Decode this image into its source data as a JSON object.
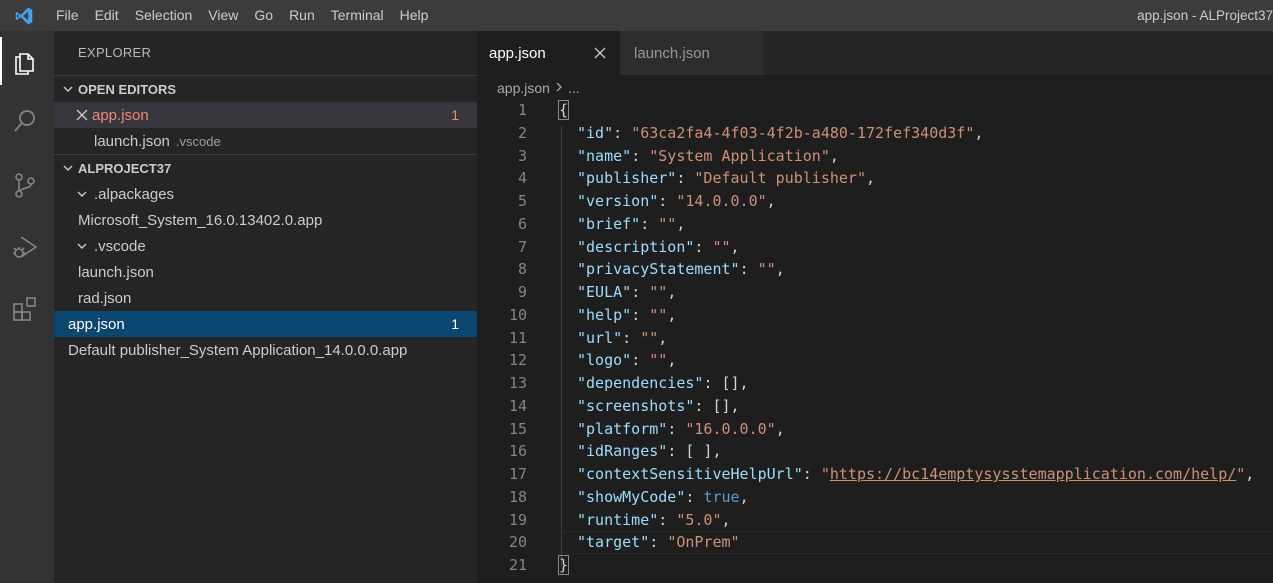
{
  "titlebar": {
    "menu": [
      "File",
      "Edit",
      "Selection",
      "View",
      "Go",
      "Run",
      "Terminal",
      "Help"
    ],
    "window_title": "app.json - ALProject37"
  },
  "activity_bar": {
    "icons": [
      "explorer-icon",
      "search-icon",
      "source-control-icon",
      "run-debug-icon",
      "extensions-icon"
    ]
  },
  "sidebar": {
    "title": "EXPLORER",
    "open_editors": {
      "header": "OPEN EDITORS",
      "items": [
        {
          "name": "app.json",
          "badge": "1"
        },
        {
          "name": "launch.json",
          "desc": ".vscode"
        }
      ]
    },
    "project": {
      "header": "ALPROJECT37",
      "items": [
        {
          "name": ".alpackages"
        },
        {
          "name": "Microsoft_System_16.0.13402.0.app"
        },
        {
          "name": ".vscode"
        },
        {
          "name": "launch.json"
        },
        {
          "name": "rad.json"
        },
        {
          "name": "app.json",
          "badge": "1"
        },
        {
          "name": "Default publisher_System Application_14.0.0.0.app"
        }
      ]
    }
  },
  "tabs": [
    {
      "label": "app.json"
    },
    {
      "label": "launch.json"
    }
  ],
  "breadcrumb": {
    "file": "app.json",
    "rest": "..."
  },
  "editor": {
    "line_numbers": [
      "1",
      "2",
      "3",
      "4",
      "5",
      "6",
      "7",
      "8",
      "9",
      "10",
      "11",
      "12",
      "13",
      "14",
      "15",
      "16",
      "17",
      "18",
      "19",
      "20",
      "21"
    ],
    "lines": [
      [
        {
          "t": "p",
          "v": "{"
        }
      ],
      [
        {
          "t": "k",
          "v": "\"id\""
        },
        {
          "t": "p",
          "v": ": "
        },
        {
          "t": "s",
          "v": "\"63ca2fa4-4f03-4f2b-a480-172fef340d3f\""
        },
        {
          "t": "p",
          "v": ","
        }
      ],
      [
        {
          "t": "k",
          "v": "\"name\""
        },
        {
          "t": "p",
          "v": ": "
        },
        {
          "t": "s",
          "v": "\"System Application\""
        },
        {
          "t": "p",
          "v": ","
        }
      ],
      [
        {
          "t": "k",
          "v": "\"publisher\""
        },
        {
          "t": "p",
          "v": ": "
        },
        {
          "t": "s",
          "v": "\"Default publisher\""
        },
        {
          "t": "p",
          "v": ","
        }
      ],
      [
        {
          "t": "k",
          "v": "\"version\""
        },
        {
          "t": "p",
          "v": ": "
        },
        {
          "t": "s",
          "v": "\"14.0.0.0\""
        },
        {
          "t": "p",
          "v": ","
        }
      ],
      [
        {
          "t": "k",
          "v": "\"brief\""
        },
        {
          "t": "p",
          "v": ": "
        },
        {
          "t": "s",
          "v": "\"\""
        },
        {
          "t": "p",
          "v": ","
        }
      ],
      [
        {
          "t": "k",
          "v": "\"description\""
        },
        {
          "t": "p",
          "v": ": "
        },
        {
          "t": "s",
          "v": "\"\""
        },
        {
          "t": "p",
          "v": ","
        }
      ],
      [
        {
          "t": "k",
          "v": "\"privacyStatement\""
        },
        {
          "t": "p",
          "v": ": "
        },
        {
          "t": "s",
          "v": "\"\""
        },
        {
          "t": "p",
          "v": ","
        }
      ],
      [
        {
          "t": "k",
          "v": "\"EULA\""
        },
        {
          "t": "p",
          "v": ": "
        },
        {
          "t": "s",
          "v": "\"\""
        },
        {
          "t": "p",
          "v": ","
        }
      ],
      [
        {
          "t": "k",
          "v": "\"help\""
        },
        {
          "t": "p",
          "v": ": "
        },
        {
          "t": "s",
          "v": "\"\""
        },
        {
          "t": "p",
          "v": ","
        }
      ],
      [
        {
          "t": "k",
          "v": "\"url\""
        },
        {
          "t": "p",
          "v": ": "
        },
        {
          "t": "s",
          "v": "\"\""
        },
        {
          "t": "p",
          "v": ","
        }
      ],
      [
        {
          "t": "k",
          "v": "\"logo\""
        },
        {
          "t": "p",
          "v": ": "
        },
        {
          "t": "s",
          "v": "\"\""
        },
        {
          "t": "p",
          "v": ","
        }
      ],
      [
        {
          "t": "k",
          "v": "\"dependencies\""
        },
        {
          "t": "p",
          "v": ": [],"
        }
      ],
      [
        {
          "t": "k",
          "v": "\"screenshots\""
        },
        {
          "t": "p",
          "v": ": [],"
        }
      ],
      [
        {
          "t": "k",
          "v": "\"platform\""
        },
        {
          "t": "p",
          "v": ": "
        },
        {
          "t": "s",
          "v": "\"16.0.0.0\""
        },
        {
          "t": "p",
          "v": ","
        }
      ],
      [
        {
          "t": "k",
          "v": "\"idRanges\""
        },
        {
          "t": "p",
          "v": ": [ ],"
        }
      ],
      [
        {
          "t": "k",
          "v": "\"contextSensitiveHelpUrl\""
        },
        {
          "t": "p",
          "v": ": "
        },
        {
          "t": "s",
          "v": "\""
        },
        {
          "t": "url",
          "v": "https://bc14emptysysstemapplication.com/help/"
        },
        {
          "t": "s",
          "v": "\""
        },
        {
          "t": "p",
          "v": ","
        }
      ],
      [
        {
          "t": "k",
          "v": "\"showMyCode\""
        },
        {
          "t": "p",
          "v": ": "
        },
        {
          "t": "b",
          "v": "true"
        },
        {
          "t": "p",
          "v": ","
        }
      ],
      [
        {
          "t": "k",
          "v": "\"runtime\""
        },
        {
          "t": "p",
          "v": ": "
        },
        {
          "t": "s",
          "v": "\"5.0\""
        },
        {
          "t": "p",
          "v": ","
        }
      ],
      [
        {
          "t": "k",
          "v": "\"target\""
        },
        {
          "t": "p",
          "v": ": "
        },
        {
          "t": "s",
          "v": "\"OnPrem\""
        }
      ],
      [
        {
          "t": "p",
          "v": "}"
        }
      ]
    ]
  },
  "colors": {
    "accent": "#007acc",
    "selection": "#094771",
    "modified": "#f48771"
  }
}
